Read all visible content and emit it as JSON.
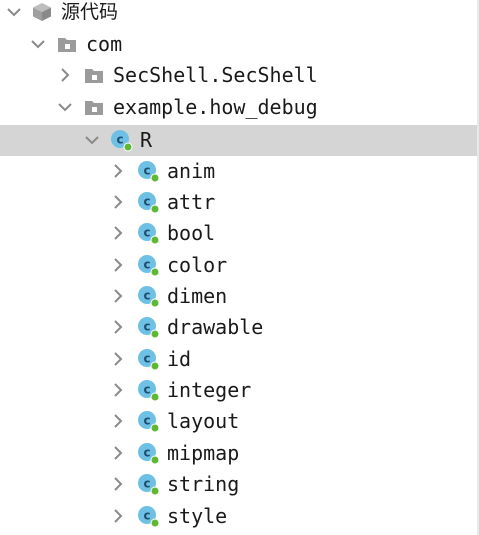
{
  "tree": {
    "root": {
      "label": "源代码",
      "icon": "source-root-icon",
      "expanded": true
    },
    "com": {
      "label": "com",
      "icon": "package-icon",
      "expanded": true
    },
    "secshell": {
      "label": "SecShell.SecShell",
      "icon": "package-icon",
      "expanded": false
    },
    "example": {
      "label": "example.how_debug",
      "icon": "package-icon",
      "expanded": true
    },
    "r_class": {
      "label": "R",
      "icon": "class-icon",
      "expanded": true,
      "selected": true
    },
    "children": [
      {
        "label": "anim",
        "icon": "class-icon"
      },
      {
        "label": "attr",
        "icon": "class-icon"
      },
      {
        "label": "bool",
        "icon": "class-icon"
      },
      {
        "label": "color",
        "icon": "class-icon"
      },
      {
        "label": "dimen",
        "icon": "class-icon"
      },
      {
        "label": "drawable",
        "icon": "class-icon"
      },
      {
        "label": "id",
        "icon": "class-icon"
      },
      {
        "label": "integer",
        "icon": "class-icon"
      },
      {
        "label": "layout",
        "icon": "class-icon"
      },
      {
        "label": "mipmap",
        "icon": "class-icon"
      },
      {
        "label": "string",
        "icon": "class-icon"
      },
      {
        "label": "style",
        "icon": "class-icon"
      }
    ]
  },
  "colors": {
    "selection": "#d5d5d5",
    "class_badge": "#6ec1e4",
    "class_dot": "#5fb832",
    "package": "#9b9b9b",
    "chevron": "#8a8a8a"
  }
}
